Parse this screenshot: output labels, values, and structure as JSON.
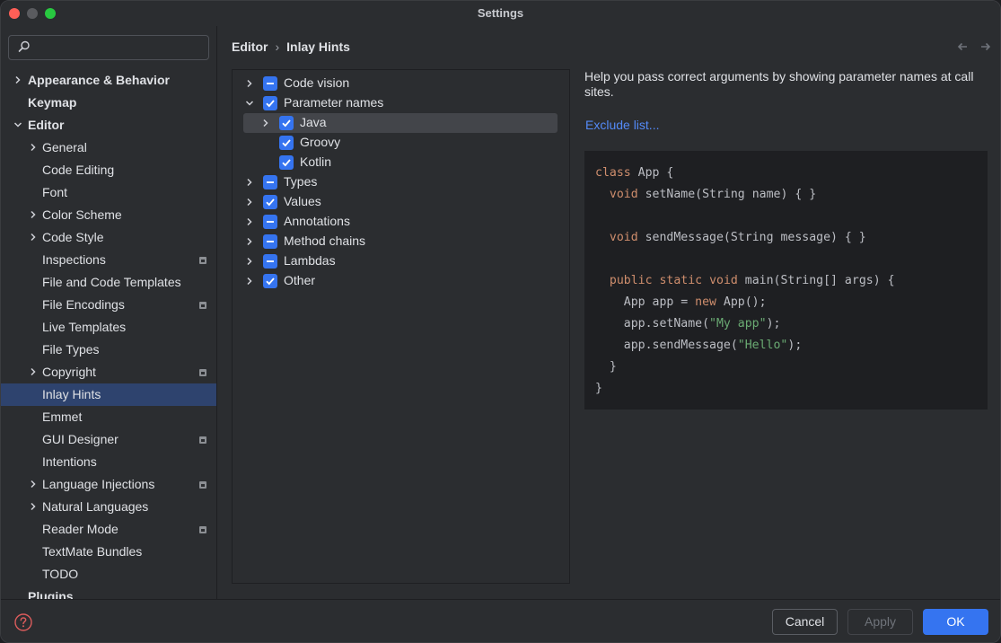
{
  "window": {
    "title": "Settings"
  },
  "search": {
    "value": "",
    "placeholder": ""
  },
  "sidebar": {
    "items": [
      {
        "label": "Appearance & Behavior",
        "expandable": true
      },
      {
        "label": "Keymap",
        "expandable": false
      },
      {
        "label": "Editor",
        "expandable": true,
        "expanded": true
      },
      {
        "label": "General",
        "expandable": true
      },
      {
        "label": "Code Editing",
        "expandable": false
      },
      {
        "label": "Font",
        "expandable": false
      },
      {
        "label": "Color Scheme",
        "expandable": true
      },
      {
        "label": "Code Style",
        "expandable": true
      },
      {
        "label": "Inspections",
        "expandable": false,
        "project_badge": true
      },
      {
        "label": "File and Code Templates",
        "expandable": false
      },
      {
        "label": "File Encodings",
        "expandable": false,
        "project_badge": true
      },
      {
        "label": "Live Templates",
        "expandable": false
      },
      {
        "label": "File Types",
        "expandable": false
      },
      {
        "label": "Copyright",
        "expandable": true,
        "project_badge": true
      },
      {
        "label": "Inlay Hints",
        "expandable": false,
        "selected": true
      },
      {
        "label": "Emmet",
        "expandable": false
      },
      {
        "label": "GUI Designer",
        "expandable": false,
        "project_badge": true
      },
      {
        "label": "Intentions",
        "expandable": false
      },
      {
        "label": "Language Injections",
        "expandable": true,
        "project_badge": true
      },
      {
        "label": "Natural Languages",
        "expandable": true
      },
      {
        "label": "Reader Mode",
        "expandable": false,
        "project_badge": true
      },
      {
        "label": "TextMate Bundles",
        "expandable": false
      },
      {
        "label": "TODO",
        "expandable": false
      },
      {
        "label": "Plugins",
        "expandable": false
      }
    ]
  },
  "breadcrumb": {
    "parent": "Editor",
    "separator": "›",
    "current": "Inlay Hints"
  },
  "options": [
    {
      "label": "Code vision",
      "state": "partial",
      "chevron": "right"
    },
    {
      "label": "Parameter names",
      "state": "checked",
      "chevron": "down"
    },
    {
      "label": "Java",
      "state": "checked",
      "chevron": "right",
      "highlighted": true
    },
    {
      "label": "Groovy",
      "state": "checked",
      "chevron": "none"
    },
    {
      "label": "Kotlin",
      "state": "checked",
      "chevron": "none"
    },
    {
      "label": "Types",
      "state": "partial",
      "chevron": "right"
    },
    {
      "label": "Values",
      "state": "checked",
      "chevron": "right"
    },
    {
      "label": "Annotations",
      "state": "partial",
      "chevron": "right"
    },
    {
      "label": "Method chains",
      "state": "partial",
      "chevron": "right"
    },
    {
      "label": "Lambdas",
      "state": "partial",
      "chevron": "right"
    },
    {
      "label": "Other",
      "state": "checked",
      "chevron": "right"
    }
  ],
  "description": {
    "text": "Help you pass correct arguments by showing parameter names at call sites.",
    "link": "Exclude list..."
  },
  "code_preview": {
    "lines": [
      "class App {",
      "  void setName(String name) { }",
      "",
      "  void sendMessage(String message) { }",
      "",
      "  public static void main(String[] args) {",
      "    App app = new App();",
      "    app.setName(\"My app\");",
      "    app.sendMessage(\"Hello\");",
      "  }",
      "}"
    ]
  },
  "footer": {
    "cancel_label": "Cancel",
    "apply_label": "Apply",
    "ok_label": "OK"
  },
  "colors": {
    "accent": "#3574f0",
    "selection": "#2e436e",
    "link": "#548af7",
    "keyword": "#cf8e6d",
    "string": "#6aab73"
  }
}
